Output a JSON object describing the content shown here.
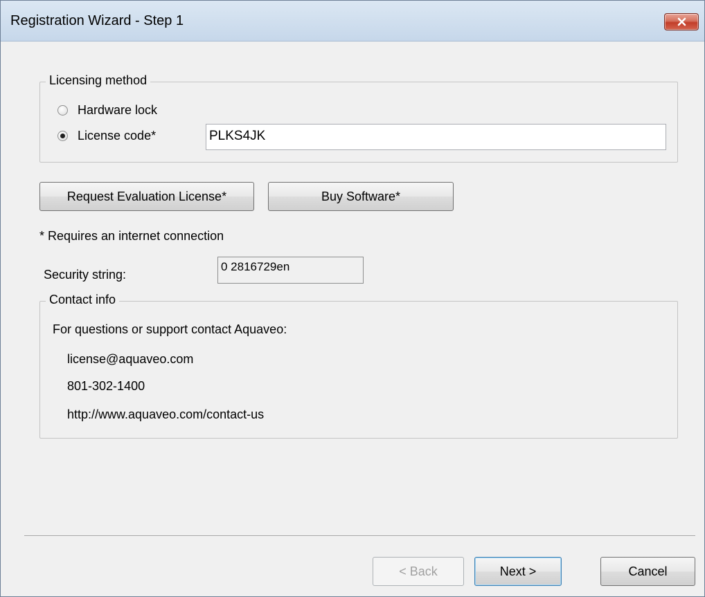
{
  "window": {
    "title": "Registration Wizard - Step 1"
  },
  "licensing": {
    "legend": "Licensing method",
    "options": [
      {
        "label": "Hardware lock",
        "checked": false
      },
      {
        "label": "License code*",
        "checked": true
      }
    ],
    "license_code_value": "PLKS4JK"
  },
  "buttons": {
    "request_eval": "Request Evaluation License*",
    "buy_software": "Buy Software*"
  },
  "note": "* Requires an internet connection",
  "security": {
    "label": "Security string:",
    "value": "0 2816729en"
  },
  "contact": {
    "legend": "Contact info",
    "intro": "For questions or support contact Aquaveo:",
    "email": "license@aquaveo.com",
    "phone": "801-302-1400",
    "url": "http://www.aquaveo.com/contact-us"
  },
  "footer": {
    "back_label": "< Back",
    "next_label": "Next >",
    "cancel_label": "Cancel"
  },
  "icons": {
    "close": "close-icon",
    "radio": "radio-icon"
  },
  "colors": {
    "close_button": "#c74a35",
    "title_bar": "#cddcec"
  }
}
